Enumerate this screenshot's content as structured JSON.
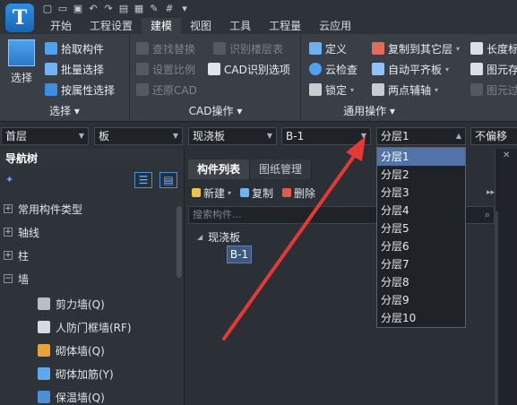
{
  "app": {
    "logo_letter": "T"
  },
  "tabs": [
    "开始",
    "工程设置",
    "建模",
    "视图",
    "工具",
    "工程量",
    "云应用"
  ],
  "active_tab": "建模",
  "ribbon": {
    "select_group": {
      "title": "选择",
      "big_button": "选择",
      "items": [
        "拾取构件",
        "批量选择",
        "按属性选择"
      ]
    },
    "cad_group": {
      "title": "CAD操作",
      "items": [
        "查找替换",
        "识别楼层表",
        "设置比例",
        "CAD识别选项",
        "还原CAD"
      ]
    },
    "common_group": {
      "title": "通用操作",
      "items": [
        "定义",
        "复制到其它层",
        "长度标",
        "云检查",
        "自动平齐板",
        "图元存",
        "锁定",
        "两点辅轴",
        "图元过"
      ]
    }
  },
  "selectors": {
    "floor": "首层",
    "category": "板",
    "type": "现浇板",
    "component": "B-1",
    "layer": "分层1",
    "offset": "不偏移"
  },
  "nav": {
    "title": "导航树",
    "items": [
      "常用构件类型",
      "轴线",
      "柱",
      "墙"
    ],
    "wall_children": [
      "剪力墙(Q)",
      "人防门框墙(RF)",
      "砌体墙(Q)",
      "砌体加筋(Y)",
      "保温墙(Q)"
    ]
  },
  "component_list": {
    "tabs": [
      "构件列表",
      "图纸管理"
    ],
    "tools": [
      "新建",
      "复制",
      "删除"
    ],
    "search_placeholder": "搜索构件...",
    "tree_root": "现浇板",
    "tree_child": "B-1"
  },
  "dropdown": {
    "options": [
      "分层1",
      "分层2",
      "分层3",
      "分层4",
      "分层5",
      "分层6",
      "分层7",
      "分层8",
      "分层9",
      "分层10"
    ],
    "selected": "分层1"
  },
  "colors": {
    "accent": "#5273a8",
    "arrow": "#e53935"
  }
}
